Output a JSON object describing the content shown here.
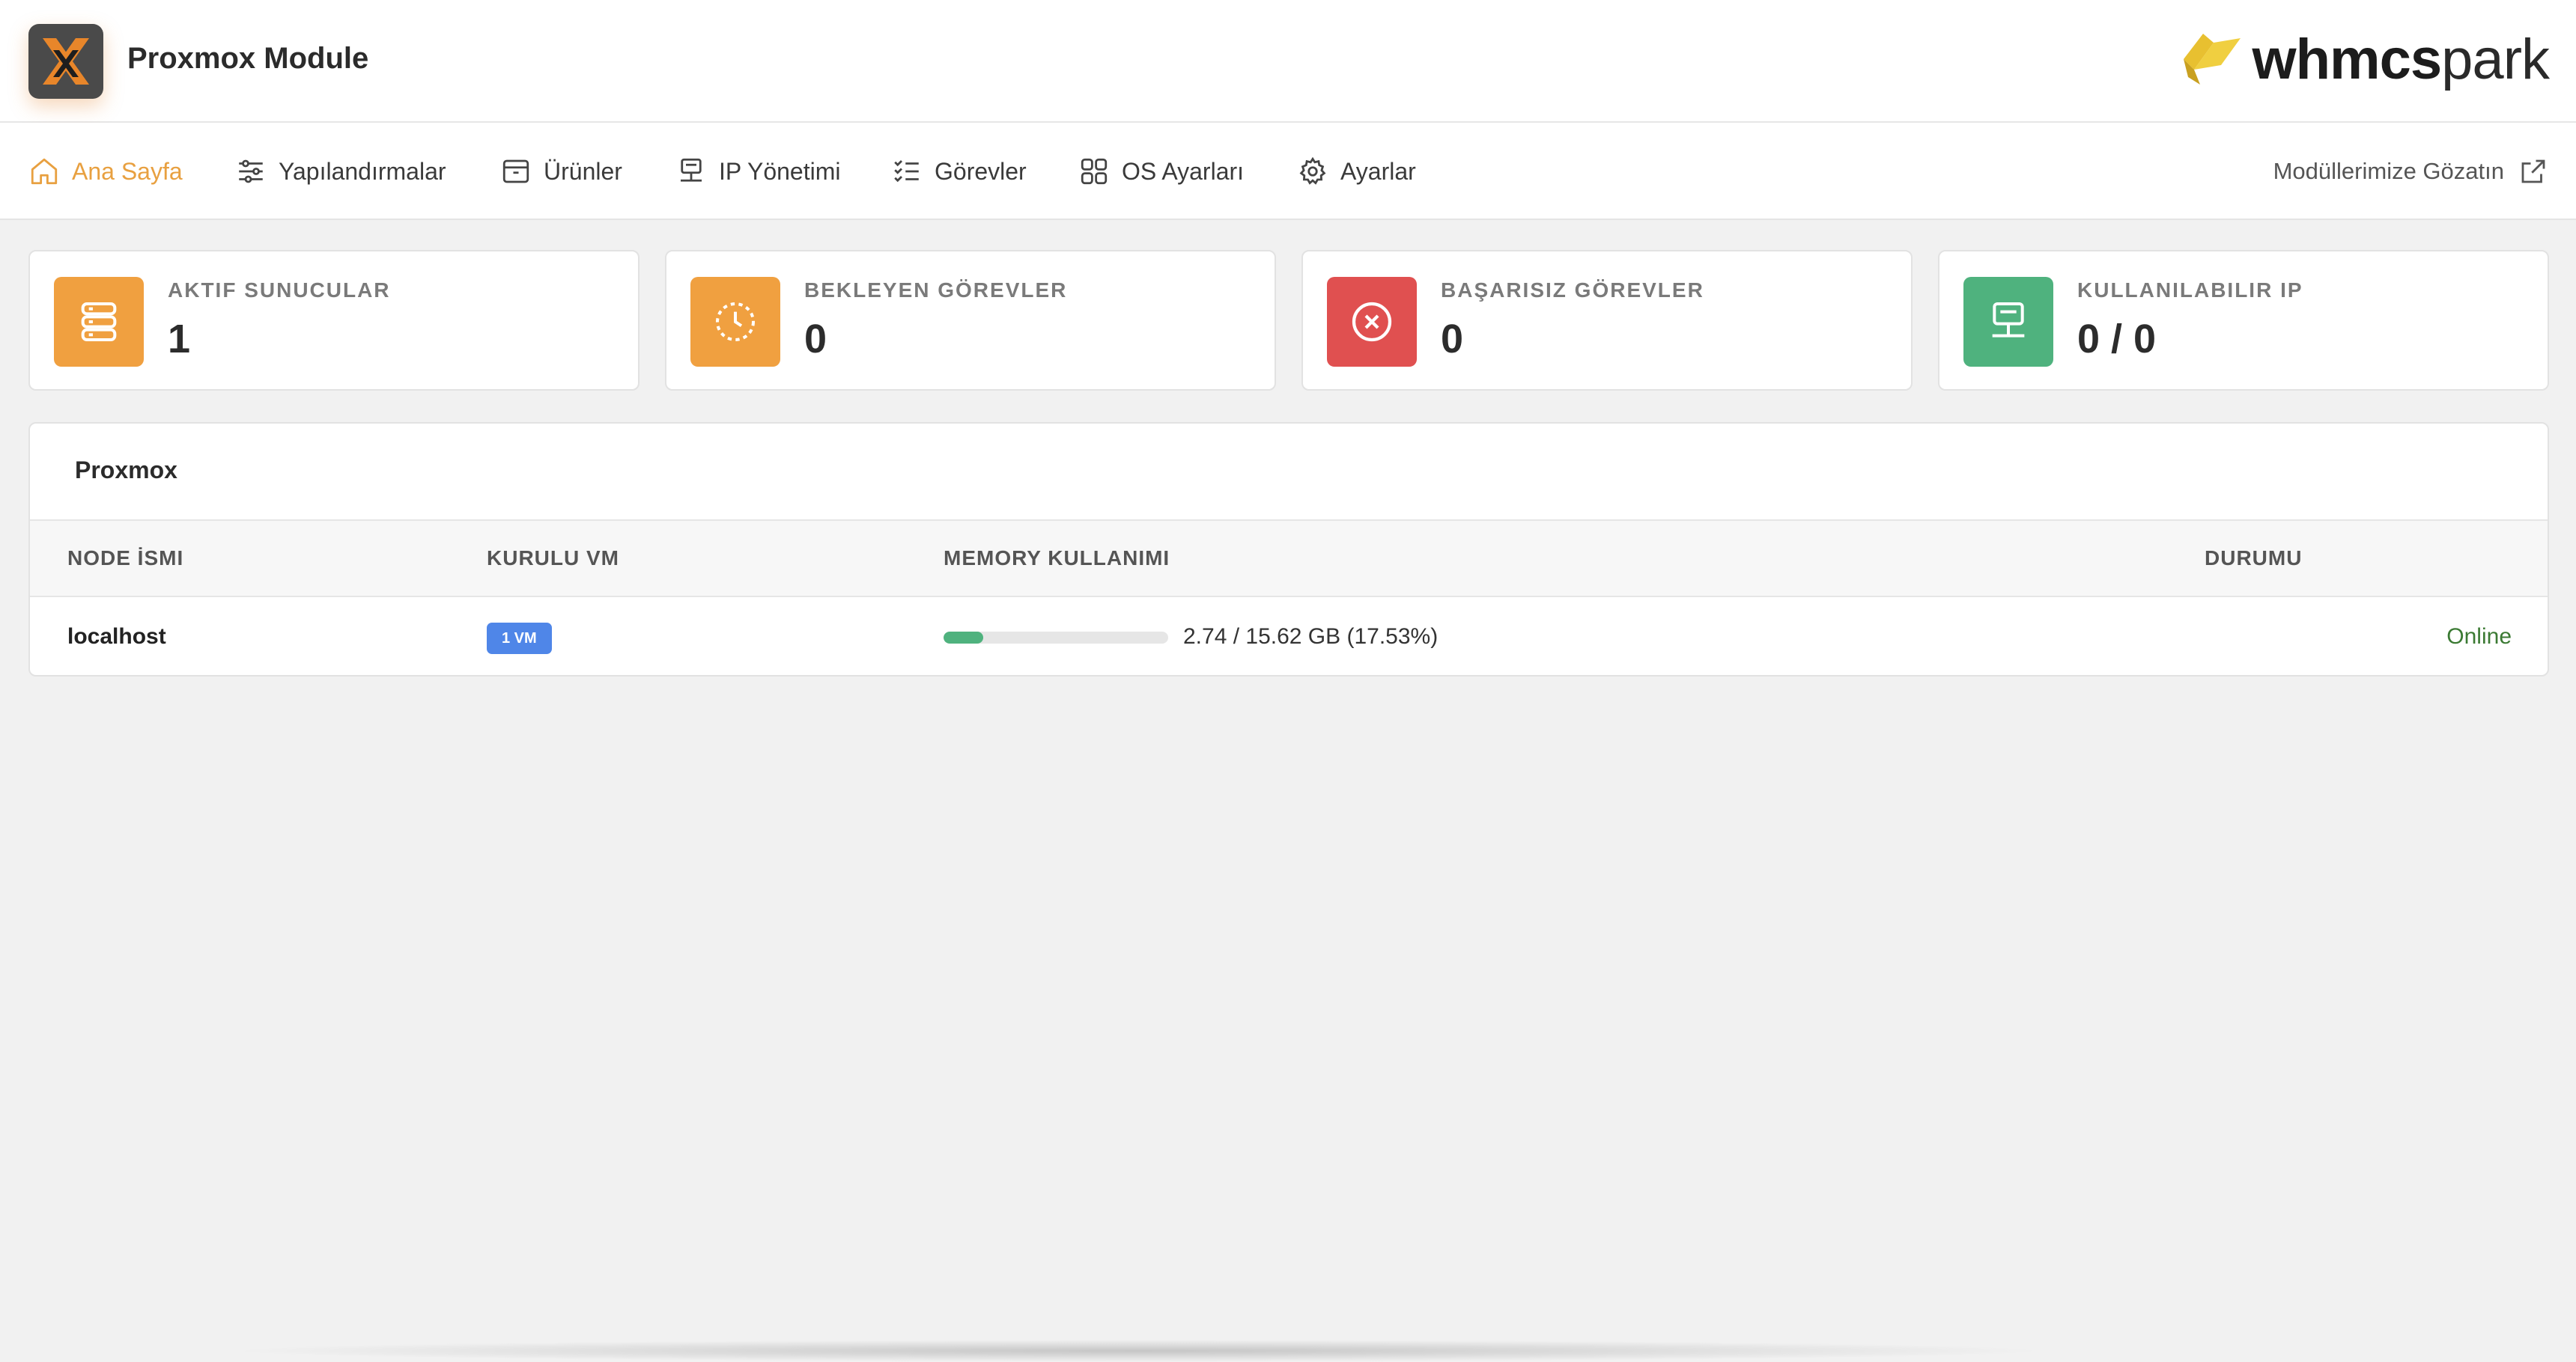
{
  "header": {
    "app_title": "Proxmox Module",
    "brand_bold": "whmcs",
    "brand_light": "park"
  },
  "nav": {
    "items": [
      {
        "label": "Ana Sayfa",
        "icon": "home-icon",
        "active": true
      },
      {
        "label": "Yapılandırmalar",
        "icon": "sliders-icon",
        "active": false
      },
      {
        "label": "Ürünler",
        "icon": "archive-icon",
        "active": false
      },
      {
        "label": "IP Yönetimi",
        "icon": "network-icon",
        "active": false
      },
      {
        "label": "Görevler",
        "icon": "checklist-icon",
        "active": false
      },
      {
        "label": "OS Ayarları",
        "icon": "grid-icon",
        "active": false
      },
      {
        "label": "Ayarlar",
        "icon": "gear-icon",
        "active": false
      }
    ],
    "external_link": "Modüllerimize Gözatın"
  },
  "stats": [
    {
      "label": "AKTIF SUNUCULAR",
      "value": "1",
      "color": "#f0a040",
      "icon": "server-icon"
    },
    {
      "label": "BEKLEYEN GÖREVLER",
      "value": "0",
      "color": "#f0a040",
      "icon": "clock-icon"
    },
    {
      "label": "BAŞARISIZ GÖREVLER",
      "value": "0",
      "color": "#e05050",
      "icon": "x-circle-icon"
    },
    {
      "label": "KULLANILABILIR IP",
      "value": "0 / 0",
      "color": "#4fb27e",
      "icon": "network-icon"
    }
  ],
  "panel": {
    "title": "Proxmox",
    "columns": [
      "NODE İSMI",
      "KURULU VM",
      "MEMORY KULLANIMI",
      "DURUMU"
    ],
    "rows": [
      {
        "node": "localhost",
        "vm_badge": "1 VM",
        "memory_text": "2.74 / 15.62 GB (17.53%)",
        "memory_percent": 17.53,
        "status": "Online"
      }
    ]
  },
  "colors": {
    "accent": "#e8a040",
    "badge": "#4f86e8",
    "memory_bar": "#4fb27e",
    "online": "#3b7a33"
  }
}
